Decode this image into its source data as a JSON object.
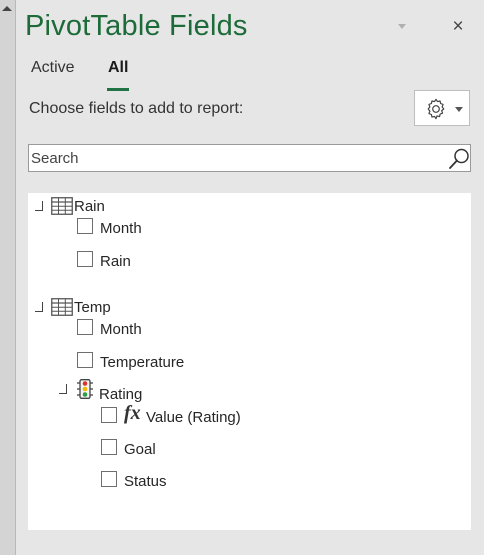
{
  "panel": {
    "title": "PivotTable Fields",
    "close_label": "×",
    "tabs": [
      {
        "label": "Active",
        "selected": false
      },
      {
        "label": "All",
        "selected": true
      }
    ],
    "choose_label": "Choose fields to add to report:",
    "settings_icon": "gear-icon"
  },
  "search": {
    "placeholder": "Search",
    "value": ""
  },
  "tables": [
    {
      "name": "Rain",
      "icon": "table-icon",
      "fields": [
        {
          "label": "Month",
          "checked": false
        },
        {
          "label": "Rain",
          "checked": false
        }
      ]
    },
    {
      "name": "Temp",
      "icon": "table-icon",
      "fields": [
        {
          "label": "Month",
          "checked": false
        },
        {
          "label": "Temperature",
          "checked": false
        }
      ],
      "kpi": {
        "name": "Rating",
        "icon": "traffic-light-icon",
        "fields": [
          {
            "label": "Value (Rating)",
            "icon": "fx-icon",
            "checked": false
          },
          {
            "label": "Goal",
            "checked": false
          },
          {
            "label": "Status",
            "checked": false
          }
        ]
      }
    }
  ],
  "colors": {
    "accent": "#217346",
    "title": "#1e6b3a",
    "panel_bg": "#e6e6e6"
  }
}
